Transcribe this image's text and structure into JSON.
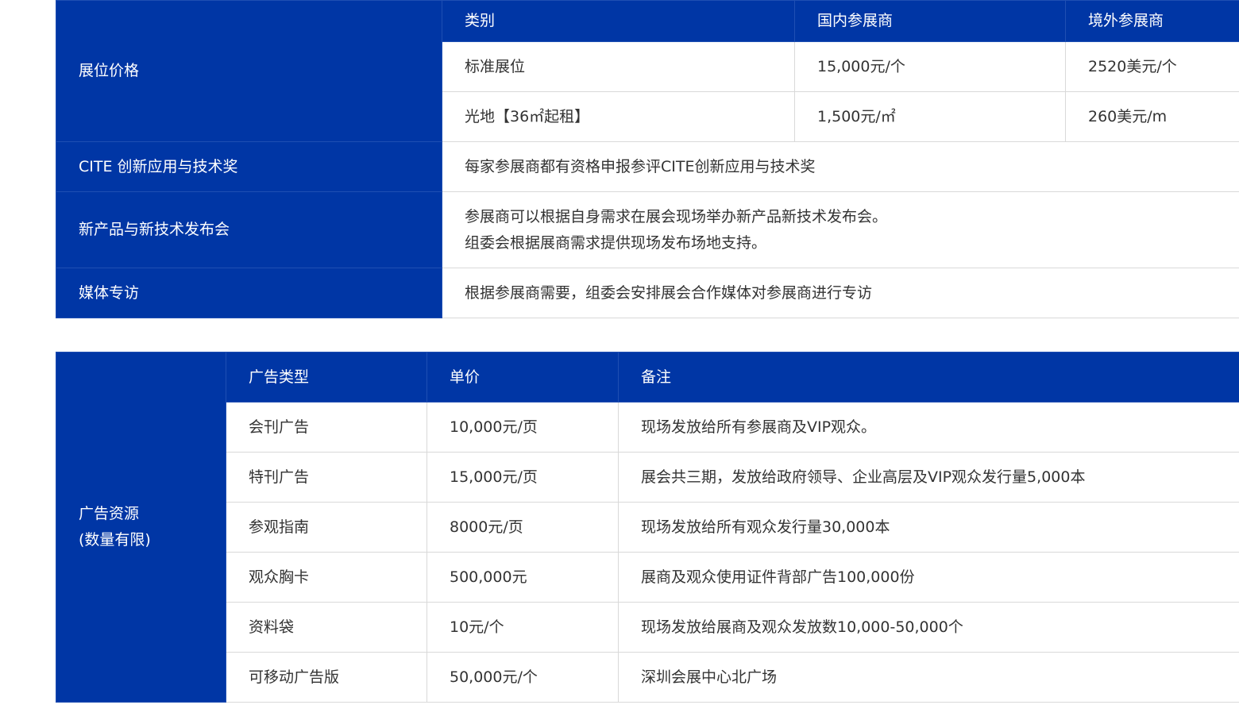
{
  "booth": {
    "section_label": "展位价格",
    "headers": [
      "类别",
      "国内参展商",
      "境外参展商"
    ],
    "rows": [
      [
        "标准展位",
        "15,000元/个",
        "2520美元/个"
      ],
      [
        "光地【36㎡起租】",
        "1,500元/㎡",
        "260美元/m"
      ]
    ]
  },
  "services": [
    {
      "label": "CITE 创新应用与技术奖",
      "lines": [
        "每家参展商都有资格申报参评CITE创新应用与技术奖"
      ]
    },
    {
      "label": "新产品与新技术发布会",
      "lines": [
        "参展商可以根据自身需求在展会现场举办新产品新技术发布会。",
        "组委会根据展商需求提供现场发布场地支持。"
      ]
    },
    {
      "label": "媒体专访",
      "lines": [
        "根据参展商需要，组委会安排展会合作媒体对参展商进行专访"
      ]
    }
  ],
  "ads": {
    "section_label_line1": "广告资源",
    "section_label_line2": "(数量有限)",
    "headers": [
      "广告类型",
      "单价",
      "备注"
    ],
    "rows": [
      [
        "会刊广告",
        "10,000元/页",
        "现场发放给所有参展商及VIP观众。"
      ],
      [
        "特刊广告",
        "15,000元/页",
        "展会共三期，发放给政府领导、企业高层及VIP观众发行量5,000本"
      ],
      [
        "参观指南",
        "8000元/页",
        "现场发放给所有观众发行量30,000本"
      ],
      [
        "观众胸卡",
        "500,000元",
        "展商及观众使用证件背部广告100,000份"
      ],
      [
        "资料袋",
        "10元/个",
        "现场发放给展商及观众发放数10,000-50,000个"
      ],
      [
        "可移动广告版",
        "50,000元/个",
        "深圳会展中心北广场"
      ]
    ]
  },
  "colors": {
    "primary_blue": "#0036a5",
    "border_gray": "#d9d9d9",
    "text": "#333333"
  }
}
